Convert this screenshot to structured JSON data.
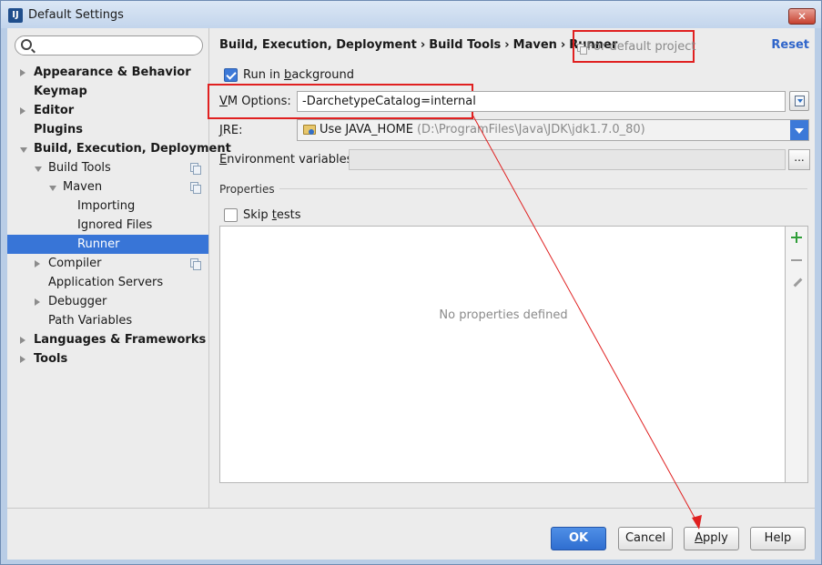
{
  "window": {
    "title": "Default Settings",
    "app_icon_text": "IJ",
    "close_glyph": "✕"
  },
  "sidebar": {
    "search_placeholder": "",
    "items": [
      {
        "label": "Appearance & Behavior",
        "level": 0,
        "bold": true,
        "arrow": "right",
        "copy": false,
        "selected": false
      },
      {
        "label": "Keymap",
        "level": 0,
        "bold": true,
        "arrow": "none",
        "copy": false,
        "selected": false
      },
      {
        "label": "Editor",
        "level": 0,
        "bold": true,
        "arrow": "right",
        "copy": false,
        "selected": false
      },
      {
        "label": "Plugins",
        "level": 0,
        "bold": true,
        "arrow": "none",
        "copy": false,
        "selected": false
      },
      {
        "label": "Build, Execution, Deployment",
        "level": 0,
        "bold": true,
        "arrow": "down",
        "copy": false,
        "selected": false
      },
      {
        "label": "Build Tools",
        "level": 1,
        "bold": false,
        "arrow": "down",
        "copy": true,
        "selected": false
      },
      {
        "label": "Maven",
        "level": 2,
        "bold": false,
        "arrow": "down",
        "copy": true,
        "selected": false
      },
      {
        "label": "Importing",
        "level": 3,
        "bold": false,
        "arrow": "none",
        "copy": false,
        "selected": false
      },
      {
        "label": "Ignored Files",
        "level": 3,
        "bold": false,
        "arrow": "none",
        "copy": false,
        "selected": false
      },
      {
        "label": "Runner",
        "level": 3,
        "bold": false,
        "arrow": "none",
        "copy": false,
        "selected": true
      },
      {
        "label": "Compiler",
        "level": 1,
        "bold": false,
        "arrow": "right",
        "copy": true,
        "selected": false
      },
      {
        "label": "Application Servers",
        "level": 1,
        "bold": false,
        "arrow": "none",
        "copy": false,
        "selected": false
      },
      {
        "label": "Debugger",
        "level": 1,
        "bold": false,
        "arrow": "right",
        "copy": false,
        "selected": false
      },
      {
        "label": "Path Variables",
        "level": 1,
        "bold": false,
        "arrow": "none",
        "copy": false,
        "selected": false
      },
      {
        "label": "Languages & Frameworks",
        "level": 0,
        "bold": true,
        "arrow": "right",
        "copy": false,
        "selected": false
      },
      {
        "label": "Tools",
        "level": 0,
        "bold": true,
        "arrow": "right",
        "copy": false,
        "selected": false
      }
    ]
  },
  "header": {
    "breadcrumb": [
      "Build, Execution, Deployment",
      "Build Tools",
      "Maven",
      "Runner"
    ],
    "separator": "›",
    "default_project": "For default project",
    "reset": "Reset"
  },
  "form": {
    "run_in_background": {
      "label_pre": "Run in ",
      "label_mn": "b",
      "label_post": "ackground",
      "checked": true
    },
    "vm_options": {
      "label_mn": "V",
      "label_post": "M Options:",
      "value": "-DarchetypeCatalog=internal"
    },
    "jre": {
      "label_mn": "J",
      "label_post": "RE:",
      "value": "Use JAVA_HOME",
      "path": "(D:\\ProgramFiles\\Java\\JDK\\jdk1.7.0_80)"
    },
    "env": {
      "label_mn": "E",
      "label_post": "nvironment variables:",
      "value": "",
      "dots": "..."
    },
    "properties_title": "Properties",
    "skip_tests": {
      "label_pre": "Skip ",
      "label_mn": "t",
      "label_post": "ests",
      "checked": false
    },
    "empty_text": "No properties defined"
  },
  "buttons": {
    "ok": "OK",
    "cancel": "Cancel",
    "apply_mn": "A",
    "apply_post": "pply",
    "help": "Help"
  },
  "colors": {
    "selection": "#3875d7",
    "annotation": "#e02020",
    "link": "#2f65ca",
    "add": "#2f9e38"
  }
}
